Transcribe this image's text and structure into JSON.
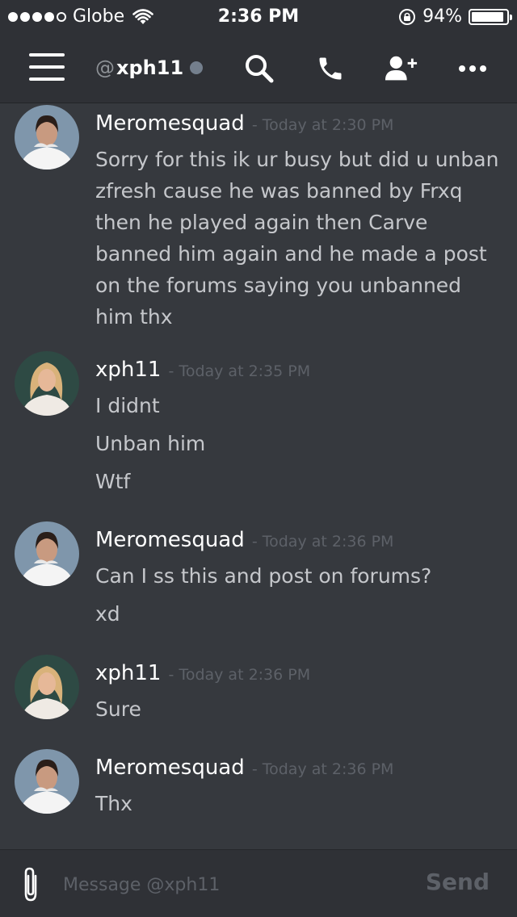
{
  "status_bar": {
    "carrier": "Globe",
    "time": "2:36 PM",
    "battery_percent": "94%",
    "battery_level": 0.94,
    "signal_bars_filled": 4,
    "signal_bars_total": 5
  },
  "header": {
    "at_symbol": "@",
    "username": "xph11",
    "icons": [
      "menu-icon",
      "search-icon",
      "phone-icon",
      "add-user-icon",
      "more-icon"
    ]
  },
  "messages": [
    {
      "author": "Meromesquad",
      "timestamp": "- Today at 2:30 PM",
      "avatar": "meromesquad-avatar",
      "lines": [
        "Sorry for this ik ur busy but did u unban zfresh cause he was banned by Frxq then he played again then Carve banned him again and he made a post on the forums saying you unbanned him thx"
      ]
    },
    {
      "author": "xph11",
      "timestamp": "- Today at 2:35 PM",
      "avatar": "xph11-avatar",
      "lines": [
        "I didnt",
        "Unban him",
        "Wtf"
      ]
    },
    {
      "author": "Meromesquad",
      "timestamp": "- Today at 2:36 PM",
      "avatar": "meromesquad-avatar",
      "lines": [
        "Can I ss this and post on forums?",
        "xd"
      ]
    },
    {
      "author": "xph11",
      "timestamp": "- Today at 2:36 PM",
      "avatar": "xph11-avatar",
      "lines": [
        "Sure"
      ]
    },
    {
      "author": "Meromesquad",
      "timestamp": "- Today at 2:36 PM",
      "avatar": "meromesquad-avatar",
      "lines": [
        "Thx"
      ]
    }
  ],
  "input": {
    "placeholder": "Message @xph11",
    "value": "",
    "send_label": "Send"
  },
  "colors": {
    "background": "#36393e",
    "header": "#2f3136",
    "timestamp": "#5d6168",
    "presence_offline": "#747f8d"
  }
}
